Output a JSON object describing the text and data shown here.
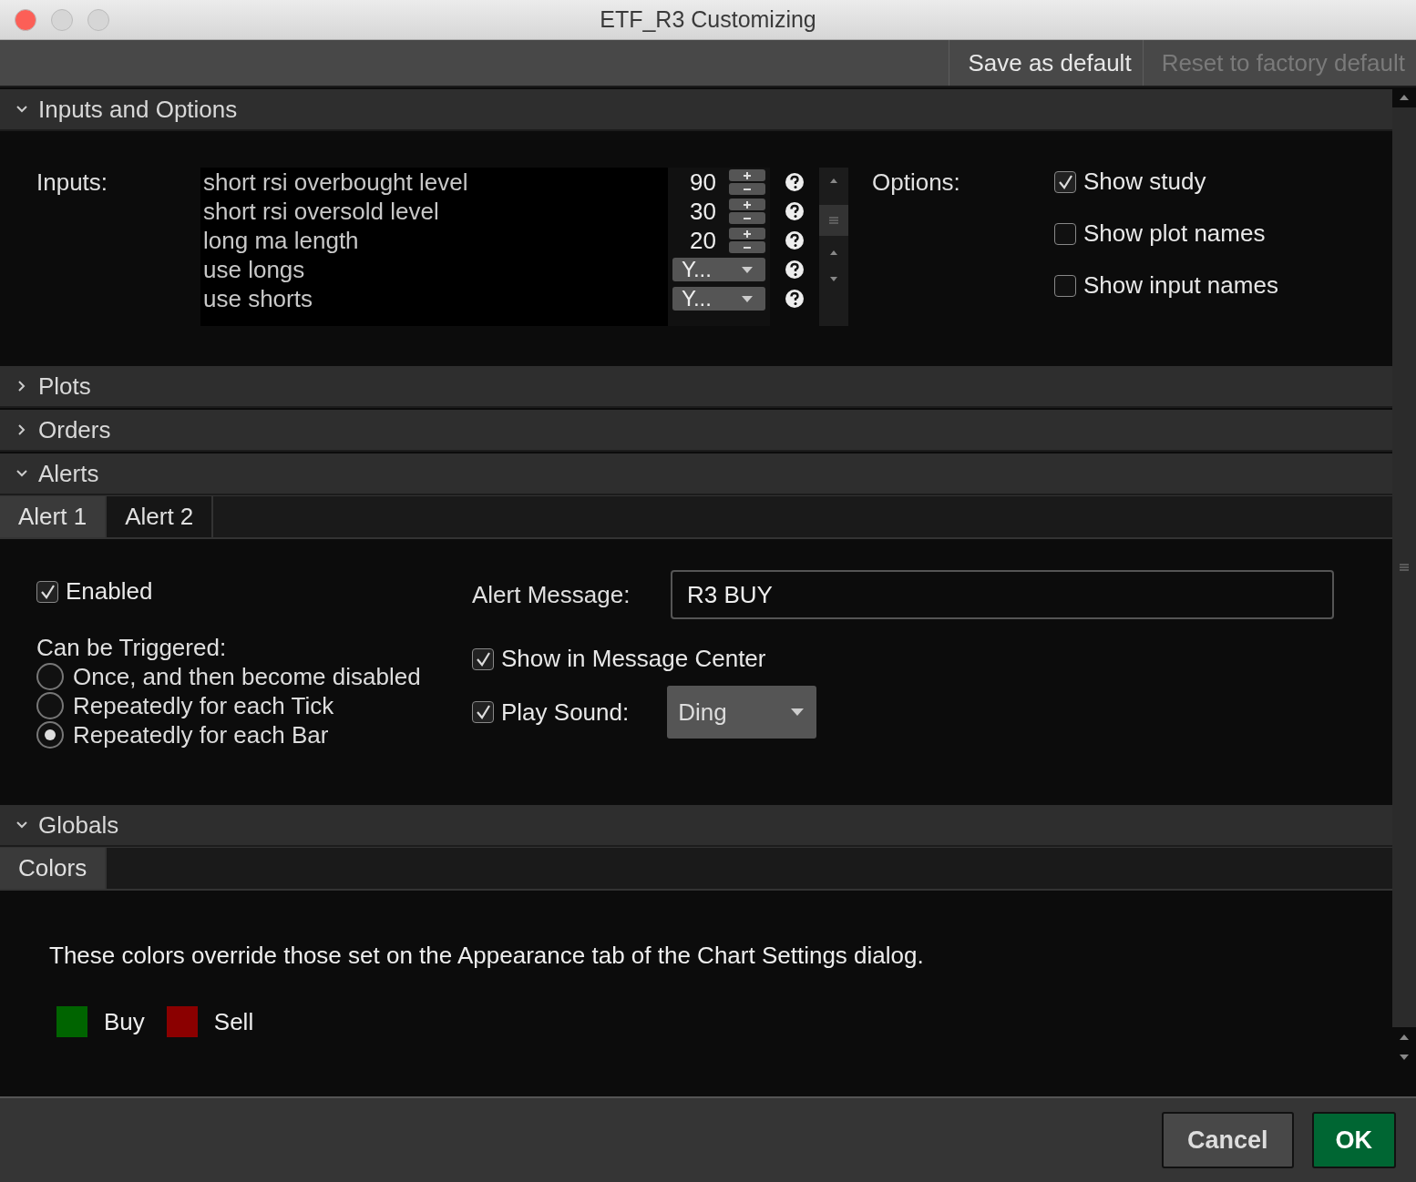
{
  "window": {
    "title": "ETF_R3 Customizing"
  },
  "toolbar": [
    {
      "label": "Save as default",
      "disabled": false
    },
    {
      "label": "Reset to factory default",
      "disabled": true
    }
  ],
  "sections": [
    {
      "kind": "inputs",
      "title": "Inputs and Options",
      "expanded": true,
      "inputs_label": "Inputs:",
      "inputs": [
        {
          "name": "short rsi overbought level",
          "kind": "number",
          "value": "90"
        },
        {
          "name": "short rsi oversold level",
          "kind": "number",
          "value": "30"
        },
        {
          "name": "long ma length",
          "kind": "number",
          "value": "20"
        },
        {
          "name": "use longs",
          "kind": "select",
          "value": "Y..."
        },
        {
          "name": "use shorts",
          "kind": "select",
          "value": "Y..."
        }
      ],
      "options_label": "Options:",
      "options": [
        {
          "label": "Show study",
          "checked": true
        },
        {
          "label": "Show plot names",
          "checked": false
        },
        {
          "label": "Show input names",
          "checked": false
        }
      ]
    },
    {
      "title": "Plots",
      "expanded": false
    },
    {
      "title": "Orders",
      "expanded": false
    },
    {
      "kind": "alerts",
      "title": "Alerts",
      "expanded": true,
      "tabs": [
        {
          "label": "Alert 1",
          "selected": true
        },
        {
          "label": "Alert 2",
          "selected": false
        }
      ],
      "enabled": {
        "label": "Enabled",
        "checked": true
      },
      "trigger_label": "Can be Triggered:",
      "triggers": [
        {
          "label": "Once, and then become disabled",
          "selected": false
        },
        {
          "label": "Repeatedly for each Tick",
          "selected": false
        },
        {
          "label": "Repeatedly for each Bar",
          "selected": true
        }
      ],
      "message_label": "Alert Message:",
      "message": "R3 BUY",
      "message_center": {
        "label": "Show in Message Center",
        "checked": true
      },
      "play_sound": {
        "label": "Play Sound:",
        "checked": true
      },
      "sound": "Ding"
    },
    {
      "kind": "globals",
      "title": "Globals",
      "expanded": true,
      "tabs": [
        {
          "label": "Colors",
          "selected": true
        }
      ],
      "note": "These colors override those set on the Appearance tab of the Chart Settings dialog.",
      "colors": [
        {
          "label": "Buy",
          "color": "#006400"
        },
        {
          "label": "Sell",
          "color": "#8b0000"
        }
      ]
    }
  ],
  "footer": [
    {
      "label": "Cancel",
      "kind": "cancel"
    },
    {
      "label": "OK",
      "kind": "ok"
    }
  ]
}
